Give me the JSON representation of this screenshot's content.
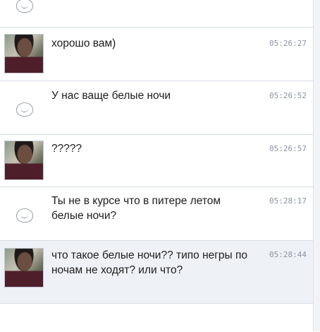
{
  "messages": [
    {
      "type": "meme",
      "meme_text": "",
      "text": "",
      "time": ""
    },
    {
      "type": "photo",
      "meme_text": "",
      "text": "хорошо вам)",
      "time": "05:26:27"
    },
    {
      "type": "meme",
      "meme_text": "",
      "text": "У нас ваще белые ночи",
      "time": "05:26:52"
    },
    {
      "type": "photo",
      "meme_text": "",
      "text": "?????",
      "time": "05:26:57"
    },
    {
      "type": "meme",
      "meme_text": "",
      "text": "Ты не в курсе что в питере летом белые ночи?",
      "time": "05:28:17"
    },
    {
      "type": "photo",
      "meme_text": "",
      "text": "что такое белые ночи?? типо негры по ночам не ходят? или что?",
      "time": "05:28:44"
    }
  ],
  "icons": {
    "avatar_photo": "user-photo",
    "avatar_meme": "troll-face-icon"
  },
  "colors": {
    "row_alt": "#eef1f6",
    "divider": "#d7dce6",
    "time": "#8a93a6",
    "text": "#1d1d1d"
  }
}
